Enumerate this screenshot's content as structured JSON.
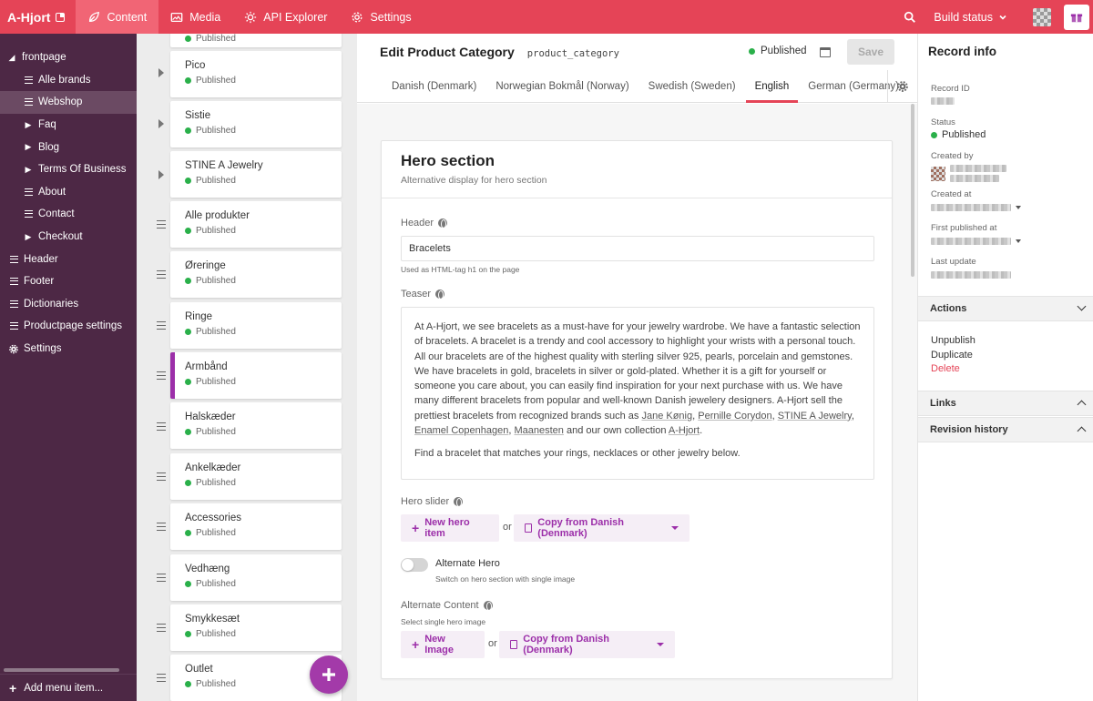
{
  "topbar": {
    "brand": "A-Hjort",
    "tabs": [
      {
        "label": "Content",
        "icon": "leaf-icon",
        "active": true
      },
      {
        "label": "Media",
        "icon": "image-icon",
        "active": false
      },
      {
        "label": "API Explorer",
        "icon": "cog-api-icon",
        "active": false
      },
      {
        "label": "Settings",
        "icon": "gear-icon",
        "active": false
      }
    ],
    "build_status": "Build status",
    "accent": "#e54457"
  },
  "sidebar": {
    "root": "frontpage",
    "items": [
      {
        "label": "Alle brands",
        "icon": "menu-icon",
        "indent": 1
      },
      {
        "label": "Webshop",
        "icon": "menu-icon",
        "indent": 1,
        "selected": true
      },
      {
        "label": "Faq",
        "icon": "caret-right-icon",
        "indent": 1
      },
      {
        "label": "Blog",
        "icon": "caret-right-icon",
        "indent": 1
      },
      {
        "label": "Terms Of Business",
        "icon": "caret-right-icon",
        "indent": 1
      },
      {
        "label": "About",
        "icon": "menu-icon",
        "indent": 1
      },
      {
        "label": "Contact",
        "icon": "menu-icon",
        "indent": 1
      },
      {
        "label": "Checkout",
        "icon": "caret-right-icon",
        "indent": 1
      },
      {
        "label": "Header",
        "icon": "menu-icon",
        "indent": 0
      },
      {
        "label": "Footer",
        "icon": "menu-icon",
        "indent": 0
      },
      {
        "label": "Dictionaries",
        "icon": "menu-icon",
        "indent": 0
      },
      {
        "label": "Productpage settings",
        "icon": "menu-icon",
        "indent": 0
      },
      {
        "label": "Settings",
        "icon": "gear-icon",
        "indent": 0
      }
    ],
    "add_menu_item": "Add menu item..."
  },
  "records": {
    "status_label": "Published",
    "items": [
      {
        "name": "Pico",
        "handle": "arrow"
      },
      {
        "name": "Sistie",
        "handle": "arrow"
      },
      {
        "name": "STINE A Jewelry",
        "handle": "arrow"
      },
      {
        "name": "Alle produkter",
        "handle": "bars"
      },
      {
        "name": "Øreringe",
        "handle": "bars"
      },
      {
        "name": "Ringe",
        "handle": "bars"
      },
      {
        "name": "Armbånd",
        "handle": "bars",
        "selected": true
      },
      {
        "name": "Halskæder",
        "handle": "bars"
      },
      {
        "name": "Ankelkæder",
        "handle": "bars"
      },
      {
        "name": "Accessories",
        "handle": "bars"
      },
      {
        "name": "Vedhæng",
        "handle": "bars"
      },
      {
        "name": "Smykkesæt",
        "handle": "bars"
      },
      {
        "name": "Outlet",
        "handle": "bars"
      }
    ]
  },
  "editor": {
    "title": "Edit Product Category",
    "api_key": "product_category",
    "status": "Published",
    "save": "Save",
    "tabs": [
      "Danish (Denmark)",
      "Norwegian Bokmål (Norway)",
      "Swedish (Sweden)",
      "English",
      "German (Germany)"
    ],
    "active_tab": "English",
    "section": {
      "title": "Hero section",
      "subtitle": "Alternative display for hero section"
    },
    "header": {
      "label": "Header",
      "value": "Bracelets",
      "hint": "Used as HTML-tag h1 on the page"
    },
    "teaser": {
      "label": "Teaser",
      "p1_a": "At A-Hjort, we see bracelets as a must-have for your jewelry wardrobe. We have a fantastic selection of bracelets. A bracelet is a trendy and cool accessory to highlight your wrists with a personal touch. All our bracelets are of the highest quality with sterling silver 925, pearls, porcelain and gemstones. We have bracelets in gold, bracelets in silver or gold-plated. Whether it is a gift for yourself or someone you care about, you can easily find inspiration for your next purchase with us. We have many different bracelets from popular and well-known Danish jewelery designers. A-Hjort sell the prettiest bracelets from recognized brands such as ",
      "link1": "Jane Kønig",
      "sep1": ", ",
      "link2": "Pernille Corydon",
      "sep2": ", ",
      "link3": "STINE A Jewelry",
      "sep3": ", ",
      "link4": "Enamel Copenhagen",
      "sep4": ", ",
      "link5": "Maanesten",
      "p1_b": " and our own collection ",
      "link6": "A-Hjort",
      "p1_end": ".",
      "p2": "Find a bracelet that matches your rings, necklaces or other jewelry below."
    },
    "hero_slider": {
      "label": "Hero slider",
      "new_button": "New hero item",
      "or": "or",
      "copy_button": "Copy from Danish (Denmark)"
    },
    "alternate_hero": {
      "label": "Alternate Hero",
      "hint": "Switch on hero section with single image",
      "enabled": false
    },
    "alternate_content": {
      "label": "Alternate Content",
      "hint": "Select single hero image",
      "new_button": "New Image",
      "or": "or",
      "copy_button": "Copy from Danish (Denmark)"
    }
  },
  "record_info": {
    "title": "Record info",
    "record_id_label": "Record ID",
    "status_label": "Status",
    "status_value": "Published",
    "created_by_label": "Created by",
    "created_at_label": "Created at",
    "first_published_label": "First published at",
    "last_update_label": "Last update",
    "actions_label": "Actions",
    "unpublish": "Unpublish",
    "duplicate": "Duplicate",
    "delete": "Delete",
    "links_label": "Links",
    "revision_label": "Revision history"
  }
}
